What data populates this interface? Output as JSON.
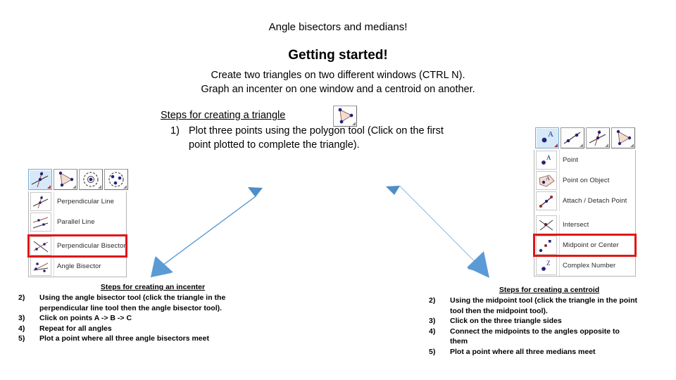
{
  "slide": {
    "title": "Angle bisectors and medians!",
    "getting_started_heading": "Getting started!",
    "intro_line_1": "Create two triangles on two different windows (CTRL N).",
    "intro_line_2": "Graph an incenter on one window and a centroid on another."
  },
  "triangle_steps": {
    "heading": "Steps for creating a triangle",
    "step_1_number": "1)",
    "step_1_text": "Plot three points using the polygon tool (Click on the first point plotted to complete the triangle).",
    "polygon_tool_icon": "polygon-tool-icon"
  },
  "left_toolbar": {
    "buttons": [
      {
        "name": "perpendicular-line-tool",
        "selected": true
      },
      {
        "name": "polygon-tool",
        "selected": false
      },
      {
        "name": "circle-with-center-tool",
        "selected": false
      },
      {
        "name": "circle-through-three-points-tool",
        "selected": false
      }
    ],
    "menu_items": [
      {
        "label": "Perpendicular Line",
        "icon": "perpendicular-line-icon",
        "highlighted": false
      },
      {
        "label": "Parallel Line",
        "icon": "parallel-line-icon",
        "highlighted": false
      },
      {
        "label": "Perpendicular Bisector",
        "icon": "perpendicular-bisector-icon",
        "highlighted": true
      },
      {
        "label": "Angle Bisector",
        "icon": "angle-bisector-icon",
        "highlighted": false
      }
    ]
  },
  "right_toolbar": {
    "buttons": [
      {
        "name": "point-tool",
        "selected": true
      },
      {
        "name": "line-tool",
        "selected": false
      },
      {
        "name": "perpendicular-line-tool",
        "selected": false
      },
      {
        "name": "polygon-tool",
        "selected": false
      }
    ],
    "menu_items": [
      {
        "label": "Point",
        "icon": "point-icon",
        "highlighted": false
      },
      {
        "label": "Point on Object",
        "icon": "point-on-object-icon",
        "highlighted": false
      },
      {
        "label": "Attach / Detach Point",
        "icon": "attach-detach-point-icon",
        "highlighted": false
      },
      {
        "label": "Intersect",
        "icon": "intersect-icon",
        "highlighted": false
      },
      {
        "label": "Midpoint or Center",
        "icon": "midpoint-or-center-icon",
        "highlighted": true
      },
      {
        "label": "Complex Number",
        "icon": "complex-number-icon",
        "highlighted": false
      }
    ]
  },
  "incenter_steps": {
    "heading": "Steps for creating an incenter",
    "items": [
      {
        "number": "2)",
        "text": "Using the angle bisector tool (click the triangle in the perpendicular line tool then the angle bisector tool)."
      },
      {
        "number": "3)",
        "text": "Click on points A -> B -> C"
      },
      {
        "number": "4)",
        "text": "Repeat for all angles"
      },
      {
        "number": "5)",
        "text": "Plot a point where all three angle bisectors meet"
      }
    ]
  },
  "centroid_steps": {
    "heading": "Steps for creating a centroid",
    "items": [
      {
        "number": "2)",
        "text": "Using the midpoint tool (click the triangle in the point tool then the midpoint tool)."
      },
      {
        "number": "3)",
        "text": "Click on the three triangle sides"
      },
      {
        "number": "4)",
        "text": "Connect the midpoints to the angles opposite to them"
      },
      {
        "number": "5)",
        "text": "Plot a point where all three medians meet"
      }
    ]
  },
  "arrows": [
    {
      "name": "arrow-to-incenter-steps",
      "direction": "down-left",
      "color": "#5b9bd5"
    },
    {
      "name": "arrow-to-centroid-steps",
      "direction": "down-right",
      "color": "#5b9bd5"
    }
  ],
  "colors": {
    "arrow_blue": "#5b9bd5",
    "highlight_red": "#e01717",
    "selected_button_blue": "#d6e9f8",
    "point_navy": "#24247a",
    "triangle_fill": "#f3ddd2"
  }
}
